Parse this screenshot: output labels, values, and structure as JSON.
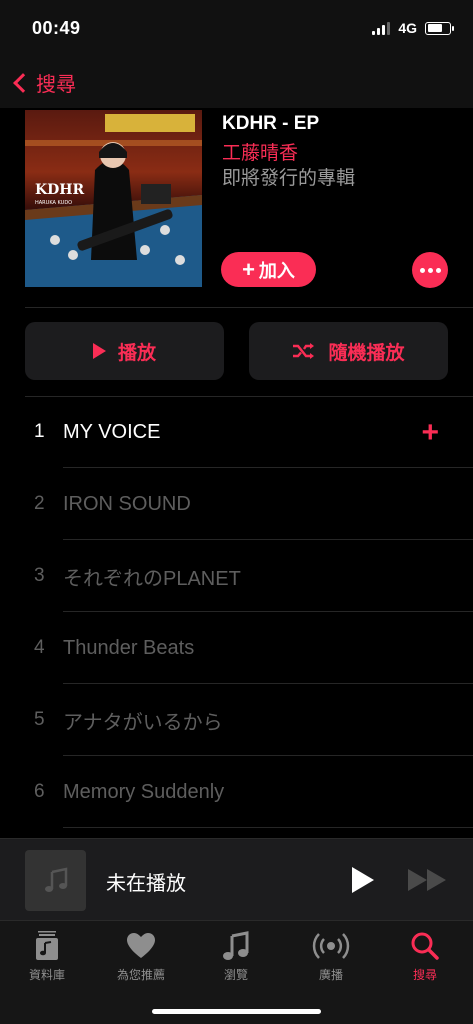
{
  "status_bar": {
    "time": "00:49",
    "network": "4G"
  },
  "nav": {
    "back_label": "搜尋",
    "back_icon": "chevron-left-icon"
  },
  "album": {
    "title": "KDHR - EP",
    "artist": "工藤晴香",
    "status": "即將發行的專輯",
    "cover_text": "KDHR",
    "cover_subtext": "HARUKA KUDO",
    "add_label": "加入",
    "accent_color": "#fa2d55"
  },
  "actions": {
    "play_label": "播放",
    "shuffle_label": "隨機播放"
  },
  "tracks": [
    {
      "number": "1",
      "title": "MY VOICE"
    },
    {
      "number": "2",
      "title": "IRON SOUND"
    },
    {
      "number": "3",
      "title": "それぞれのPLANET"
    },
    {
      "number": "4",
      "title": "Thunder Beats"
    },
    {
      "number": "5",
      "title": "アナタがいるから"
    },
    {
      "number": "6",
      "title": "Memory Suddenly"
    }
  ],
  "mini_player": {
    "title": "未在播放"
  },
  "tabs": [
    {
      "label": "資料庫",
      "icon": "library-icon"
    },
    {
      "label": "為您推薦",
      "icon": "heart-icon"
    },
    {
      "label": "瀏覽",
      "icon": "music-note-icon"
    },
    {
      "label": "廣播",
      "icon": "radio-icon"
    },
    {
      "label": "搜尋",
      "icon": "search-icon"
    }
  ]
}
